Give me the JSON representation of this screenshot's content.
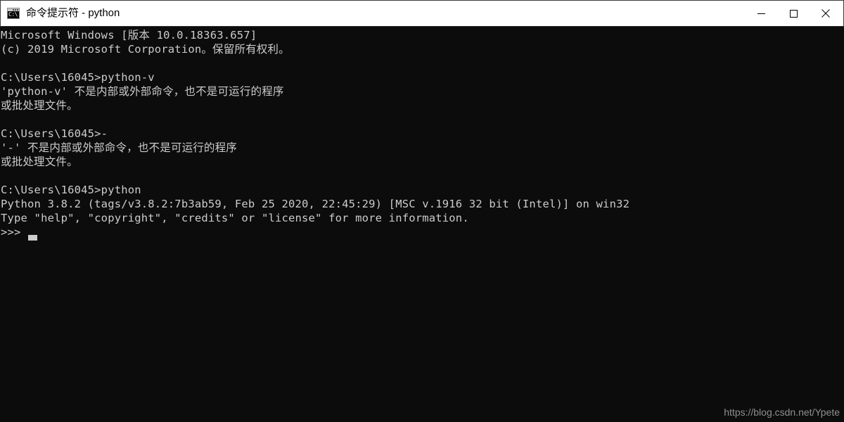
{
  "window": {
    "title": "命令提示符 - python",
    "icon_name": "cmd-icon",
    "icon_text": "C:\\.",
    "background_color": "#0c0c0c",
    "titlebar_background": "#ffffff",
    "text_color": "#cccccc",
    "controls": {
      "minimize_label": "—",
      "maximize_label": "□",
      "close_label": "✕"
    }
  },
  "console": {
    "lines": [
      "Microsoft Windows [版本 10.0.18363.657]",
      "(c) 2019 Microsoft Corporation。保留所有权利。",
      "",
      "C:\\Users\\16045>python-v",
      "'python-v' 不是内部或外部命令，也不是可运行的程序",
      "或批处理文件。",
      "",
      "C:\\Users\\16045>-",
      "'-' 不是内部或外部命令，也不是可运行的程序",
      "或批处理文件。",
      "",
      "C:\\Users\\16045>python",
      "Python 3.8.2 (tags/v3.8.2:7b3ab59, Feb 25 2020, 22:45:29) [MSC v.1916 32 bit (Intel)] on win32",
      "Type \"help\", \"copyright\", \"credits\" or \"license\" for more information.",
      ">>>"
    ],
    "prompt_path": "C:\\Users\\16045>",
    "python_prompt": ">>>",
    "cursor_visible": true
  },
  "watermark": {
    "text": "https://blog.csdn.net/Ypete"
  }
}
